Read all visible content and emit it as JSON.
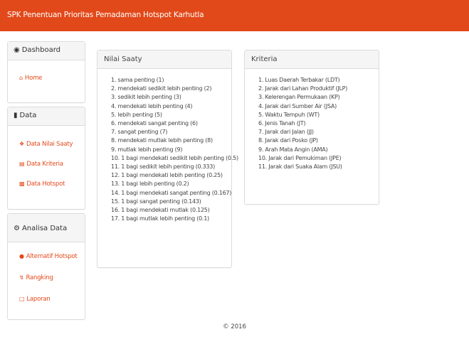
{
  "header": {
    "title": "SPK Penentuan Prioritas Pemadaman Hotspot Karhutla"
  },
  "sidebar": {
    "dashboard": {
      "title": "Dashboard",
      "icon": "dashboard-icon",
      "items": [
        {
          "label": "Home",
          "icon": "home-icon"
        }
      ]
    },
    "data": {
      "title": "Data",
      "icon": "file-icon",
      "items": [
        {
          "label": "Data Nilai Saaty",
          "icon": "scale-icon"
        },
        {
          "label": "Data Kriteria",
          "icon": "institution-icon"
        },
        {
          "label": "Data Hotspot",
          "icon": "database-icon"
        }
      ]
    },
    "analisa": {
      "title": "Analisa Data",
      "icon": "gears-icon",
      "items": [
        {
          "label": "Alternatif Hotspot",
          "icon": "fire-icon"
        },
        {
          "label": "Rangking",
          "icon": "lightning-icon"
        },
        {
          "label": "Laporan",
          "icon": "document-icon"
        }
      ]
    }
  },
  "nilai_saaty": {
    "title": "Nilai Saaty",
    "items": [
      "1. sama penting (1)",
      "2. mendekati sedikit lebih penting (2)",
      "3. sedikit lebih penting (3)",
      "4. mendekati lebih penting (4)",
      "5. lebih penting (5)",
      "6. mendekati sangat penting (6)",
      "7. sangat penting (7)",
      "8. mendekati mutlak lebih penting (8)",
      "9. mutlak lebih penting (9)",
      "10. 1 bagi mendekati sedikit lebih penting (0.5)",
      "11. 1 bagi sedikit lebih penting (0.333)",
      "12. 1 bagi mendekati lebih penting (0.25)",
      "13. 1 bagi lebih penting (0.2)",
      "14. 1 bagi mendekati sangat penting (0.167)",
      "15. 1 bagi sangat penting (0.143)",
      "16. 1 bagi mendekati mutlak (0.125)",
      "17. 1 bagi mutlak lebih penting (0.1)"
    ]
  },
  "kriteria": {
    "title": "Kriteria",
    "items": [
      "1. Luas Daerah Terbakar (LDT)",
      "2. Jarak dari Lahan Produktif (JLP)",
      "3. Kelerengan Permukaan (KP)",
      "4. Jarak dari Sumber Air (JSA)",
      "5. Waktu Tempuh (WT)",
      "6. Jenis Tanah (JT)",
      "7. Jarak dari Jalan (JJ)",
      "8. Jarak dari Posko (JP)",
      "9. Arah Mata Angin (AMA)",
      "10. Jarak dari Pemukiman (JPE)",
      "11. Jarak dari Suaka Alam (JSU)"
    ]
  },
  "footer": {
    "text": "© 2016"
  },
  "colors": {
    "accent": "#e2491a",
    "panel_head": "#f5f5f5",
    "border": "#dcdcdc"
  }
}
